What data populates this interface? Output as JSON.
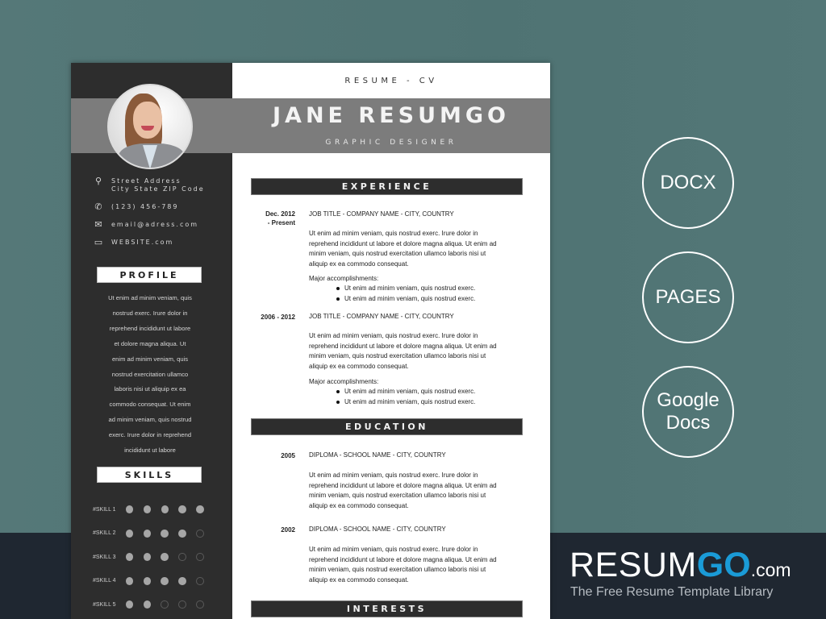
{
  "resume": {
    "header_label": "RESUME - CV",
    "name": "JANE RESUMGO",
    "job_title": "GRAPHIC DESIGNER",
    "contact": {
      "address_line1": "Street Address",
      "address_line2": "City State ZIP Code",
      "phone": "(123) 456-789",
      "email": "email@adress.com",
      "website": "WEBSITE.com"
    },
    "profile": {
      "heading": "PROFILE",
      "lines": [
        "Ut enim ad minim veniam, quis",
        "nostrud exerc. Irure dolor in",
        "reprehend incididunt ut labore",
        "et dolore magna aliqua. Ut",
        "enim ad minim veniam, quis",
        "nostrud exercitation ullamco",
        "laboris nisi ut aliquip ex ea",
        "commodo consequat. Ut enim",
        "ad minim veniam, quis nostrud",
        "exerc. Irure dolor in reprehend",
        "incididunt ut labore"
      ]
    },
    "skills": {
      "heading": "SKILLS",
      "items": [
        {
          "label": "#SKILL 1",
          "level": 5,
          "max": 5
        },
        {
          "label": "#SKILL 2",
          "level": 4,
          "max": 5
        },
        {
          "label": "#SKILL 3",
          "level": 3,
          "max": 5
        },
        {
          "label": "#SKILL 4",
          "level": 4,
          "max": 5
        },
        {
          "label": "#SKILL 5",
          "level": 2,
          "max": 5
        }
      ]
    },
    "experience": {
      "heading": "EXPERIENCE",
      "entries": [
        {
          "date_line1": "Dec. 2012",
          "date_line2": "- Present",
          "title": "JOB TITLE - COMPANY NAME - CITY, COUNTRY",
          "body": [
            "Ut enim ad minim veniam, quis nostrud exerc. Irure dolor in",
            "reprehend incididunt ut labore et dolore magna aliqua. Ut enim ad",
            "minim veniam, quis nostrud exercitation ullamco laboris nisi ut",
            "aliquip ex ea commodo consequat."
          ],
          "accomplishments_label": "Major accomplishments:",
          "accomplishments": [
            "Ut enim ad minim veniam, quis nostrud exerc.",
            "Ut enim ad minim veniam, quis nostrud exerc."
          ]
        },
        {
          "date_line1": "2006 - 2012",
          "date_line2": "",
          "title": "JOB TITLE - COMPANY NAME - CITY, COUNTRY",
          "body": [
            "Ut enim ad minim veniam, quis nostrud exerc. Irure dolor in",
            "reprehend incididunt ut labore et dolore magna aliqua. Ut enim ad",
            "minim veniam, quis nostrud exercitation ullamco laboris nisi ut",
            "aliquip ex ea commodo consequat."
          ],
          "accomplishments_label": "Major accomplishments:",
          "accomplishments": [
            "Ut enim ad minim veniam, quis nostrud exerc.",
            "Ut enim ad minim veniam, quis nostrud exerc."
          ]
        }
      ]
    },
    "education": {
      "heading": "EDUCATION",
      "entries": [
        {
          "date": "2005",
          "title": "DIPLOMA - SCHOOL NAME - CITY, COUNTRY",
          "body": [
            "Ut enim ad minim veniam, quis nostrud exerc. Irure dolor in",
            "reprehend incididunt ut labore et dolore magna aliqua. Ut enim ad",
            "minim veniam, quis nostrud exercitation ullamco laboris nisi ut",
            "aliquip ex ea commodo consequat."
          ]
        },
        {
          "date": "2002",
          "title": "DIPLOMA - SCHOOL NAME - CITY, COUNTRY",
          "body": [
            "Ut enim ad minim veniam, quis nostrud exerc. Irure dolor in",
            "reprehend incididunt ut labore et dolore magna aliqua. Ut enim ad",
            "minim veniam, quis nostrud exercitation ullamco laboris nisi ut",
            "aliquip ex ea commodo consequat."
          ]
        }
      ]
    },
    "interests": {
      "heading": "INTERESTS"
    }
  },
  "formats": [
    {
      "label": "DOCX"
    },
    {
      "label": "PAGES"
    },
    {
      "label": "Google Docs",
      "line1": "Google",
      "line2": "Docs"
    }
  ],
  "brand": {
    "name_part1": "RESUM",
    "name_part2": "GO",
    "domain": ".com",
    "tagline": "The Free Resume Template Library",
    "accent_color": "#1a9bd7"
  },
  "colors": {
    "background": "#527676",
    "bottom_band": "#1f2731",
    "sidebar": "#2d2d2d",
    "header_band": "#7c7c7c"
  }
}
